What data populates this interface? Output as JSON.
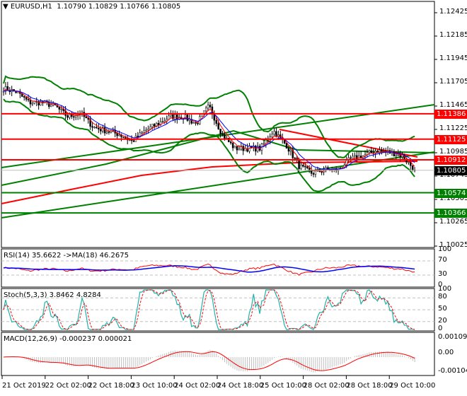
{
  "header": {
    "symbol": "EURUSD,H1",
    "ohlc": "1.10790 1.10829 1.10766 1.10805"
  },
  "price_axis": [
    "1.12425",
    "1.12185",
    "1.11945",
    "1.11705",
    "1.11465",
    "1.11225",
    "1.10985",
    "1.10745",
    "1.10505",
    "1.10265",
    "1.10025"
  ],
  "levels": [
    {
      "value": "1.11386",
      "color": "#ff0000"
    },
    {
      "value": "1.11125",
      "color": "#ff0000"
    },
    {
      "value": "1.10912",
      "color": "#ff0000"
    },
    {
      "value": "1.10574",
      "color": "#008000"
    },
    {
      "value": "1.10366",
      "color": "#008000"
    }
  ],
  "current_price": "1.10805",
  "closes": [
    1.11647,
    1.1161,
    1.11501,
    1.11501,
    1.11465,
    1.11356,
    1.11392,
    1.11247,
    1.1121,
    1.11174,
    1.11101,
    1.1121,
    1.11283,
    1.11356,
    1.11356,
    1.11283,
    1.11465,
    1.11174,
    1.11029,
    1.11029,
    1.11029,
    1.1121,
    1.11065,
    1.10847,
    1.10774,
    1.1081,
    1.1081,
    1.1092,
    1.10956,
    1.11007,
    1.10992,
    1.10956,
    1.1081
  ],
  "rsi": {
    "label": "RSI(14) 35.6622  ->MA(18) 46.2675",
    "axis": [
      "100",
      "70",
      "30",
      "0"
    ]
  },
  "stoch": {
    "label": "Stoch(5,3,3) 3.8462 4.8284",
    "axis": [
      "100",
      "80",
      "50",
      "20",
      "0"
    ]
  },
  "macd": {
    "label": "MACD(12,26,9) -0.000237 0.000021",
    "axis": [
      "0.001093",
      "0.00",
      "-0.001042"
    ]
  },
  "time_axis": [
    "21 Oct 2019",
    "22 Oct 02:00",
    "22 Oct 18:00",
    "23 Oct 10:00",
    "24 Oct 02:00",
    "24 Oct 18:00",
    "25 Oct 10:00",
    "28 Oct 02:00",
    "28 Oct 18:00",
    "29 Oct 10:00"
  ]
}
